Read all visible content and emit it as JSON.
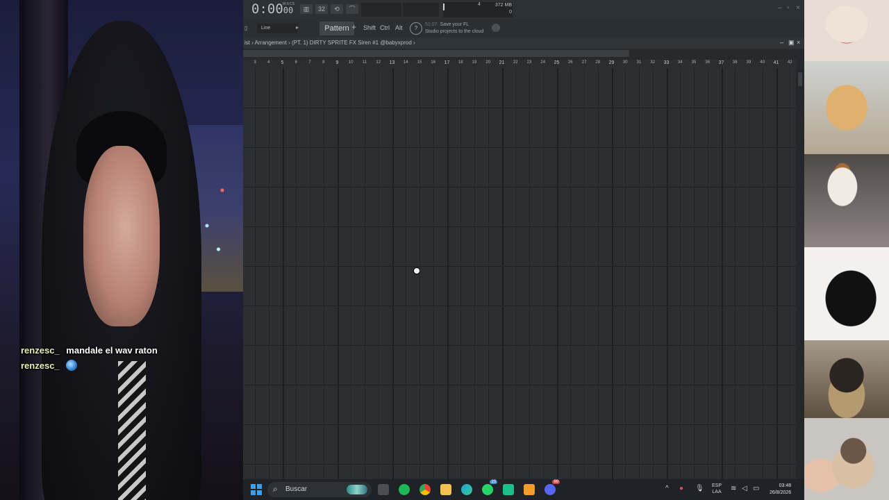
{
  "webcam": {
    "chat": [
      {
        "user": "renzesc_",
        "message": "mandale el wav raton",
        "emote": ""
      },
      {
        "user": "renzesc_",
        "message": "",
        "emote": "globe-emote"
      }
    ]
  },
  "fl_studio": {
    "toolbar": {
      "time_main": "0:00",
      "time_sub": "00",
      "time_mode": "M:S:CS",
      "cpu_value": "4",
      "cpu_sub": "0",
      "memory": "372 MB",
      "snap_label": "Line",
      "pattern_label": "Pattern 1",
      "modifier_shift": "Shift",
      "modifier_ctrl": "Ctrl",
      "modifier_alt": "Alt",
      "hint_time": "51:07",
      "hint_text_1": "Save your FL",
      "hint_text_2": "Studio projects to the cloud"
    },
    "playlist": {
      "breadcrumb": "ist › Arrangement › (PT. 1) DIRTY SPRITE FX Siren #1 @babyxprod ›",
      "ruler_major": [
        "5",
        "9",
        "13",
        "17",
        "21",
        "25",
        "29",
        "33",
        "37",
        "41"
      ],
      "ruler_minor": [
        "3",
        "4",
        "6",
        "7",
        "8",
        "10",
        "11",
        "12",
        "14",
        "15",
        "16",
        "18",
        "19",
        "20",
        "22",
        "23",
        "24",
        "26",
        "27",
        "28",
        "30",
        "31",
        "32",
        "34",
        "35",
        "36",
        "38",
        "39",
        "40",
        "42"
      ]
    }
  },
  "taskbar": {
    "search_label": "Buscar",
    "lang_line1": "ESP",
    "lang_line2": "LAA",
    "time": "03:48",
    "date": "26/8/2026",
    "whatsapp_badge": "23",
    "discord_badge": "99"
  },
  "dogs": {
    "tiles": [
      "chihuahua-red-heart",
      "golden-puppy",
      "jack-russell-car",
      "black-spaniel",
      "chihuahua-sitting",
      "pug-hug"
    ]
  },
  "colors": {
    "daw_bg": "#262a2d",
    "grid_bg": "#2b2f32",
    "accent": "#3aa0f3"
  }
}
